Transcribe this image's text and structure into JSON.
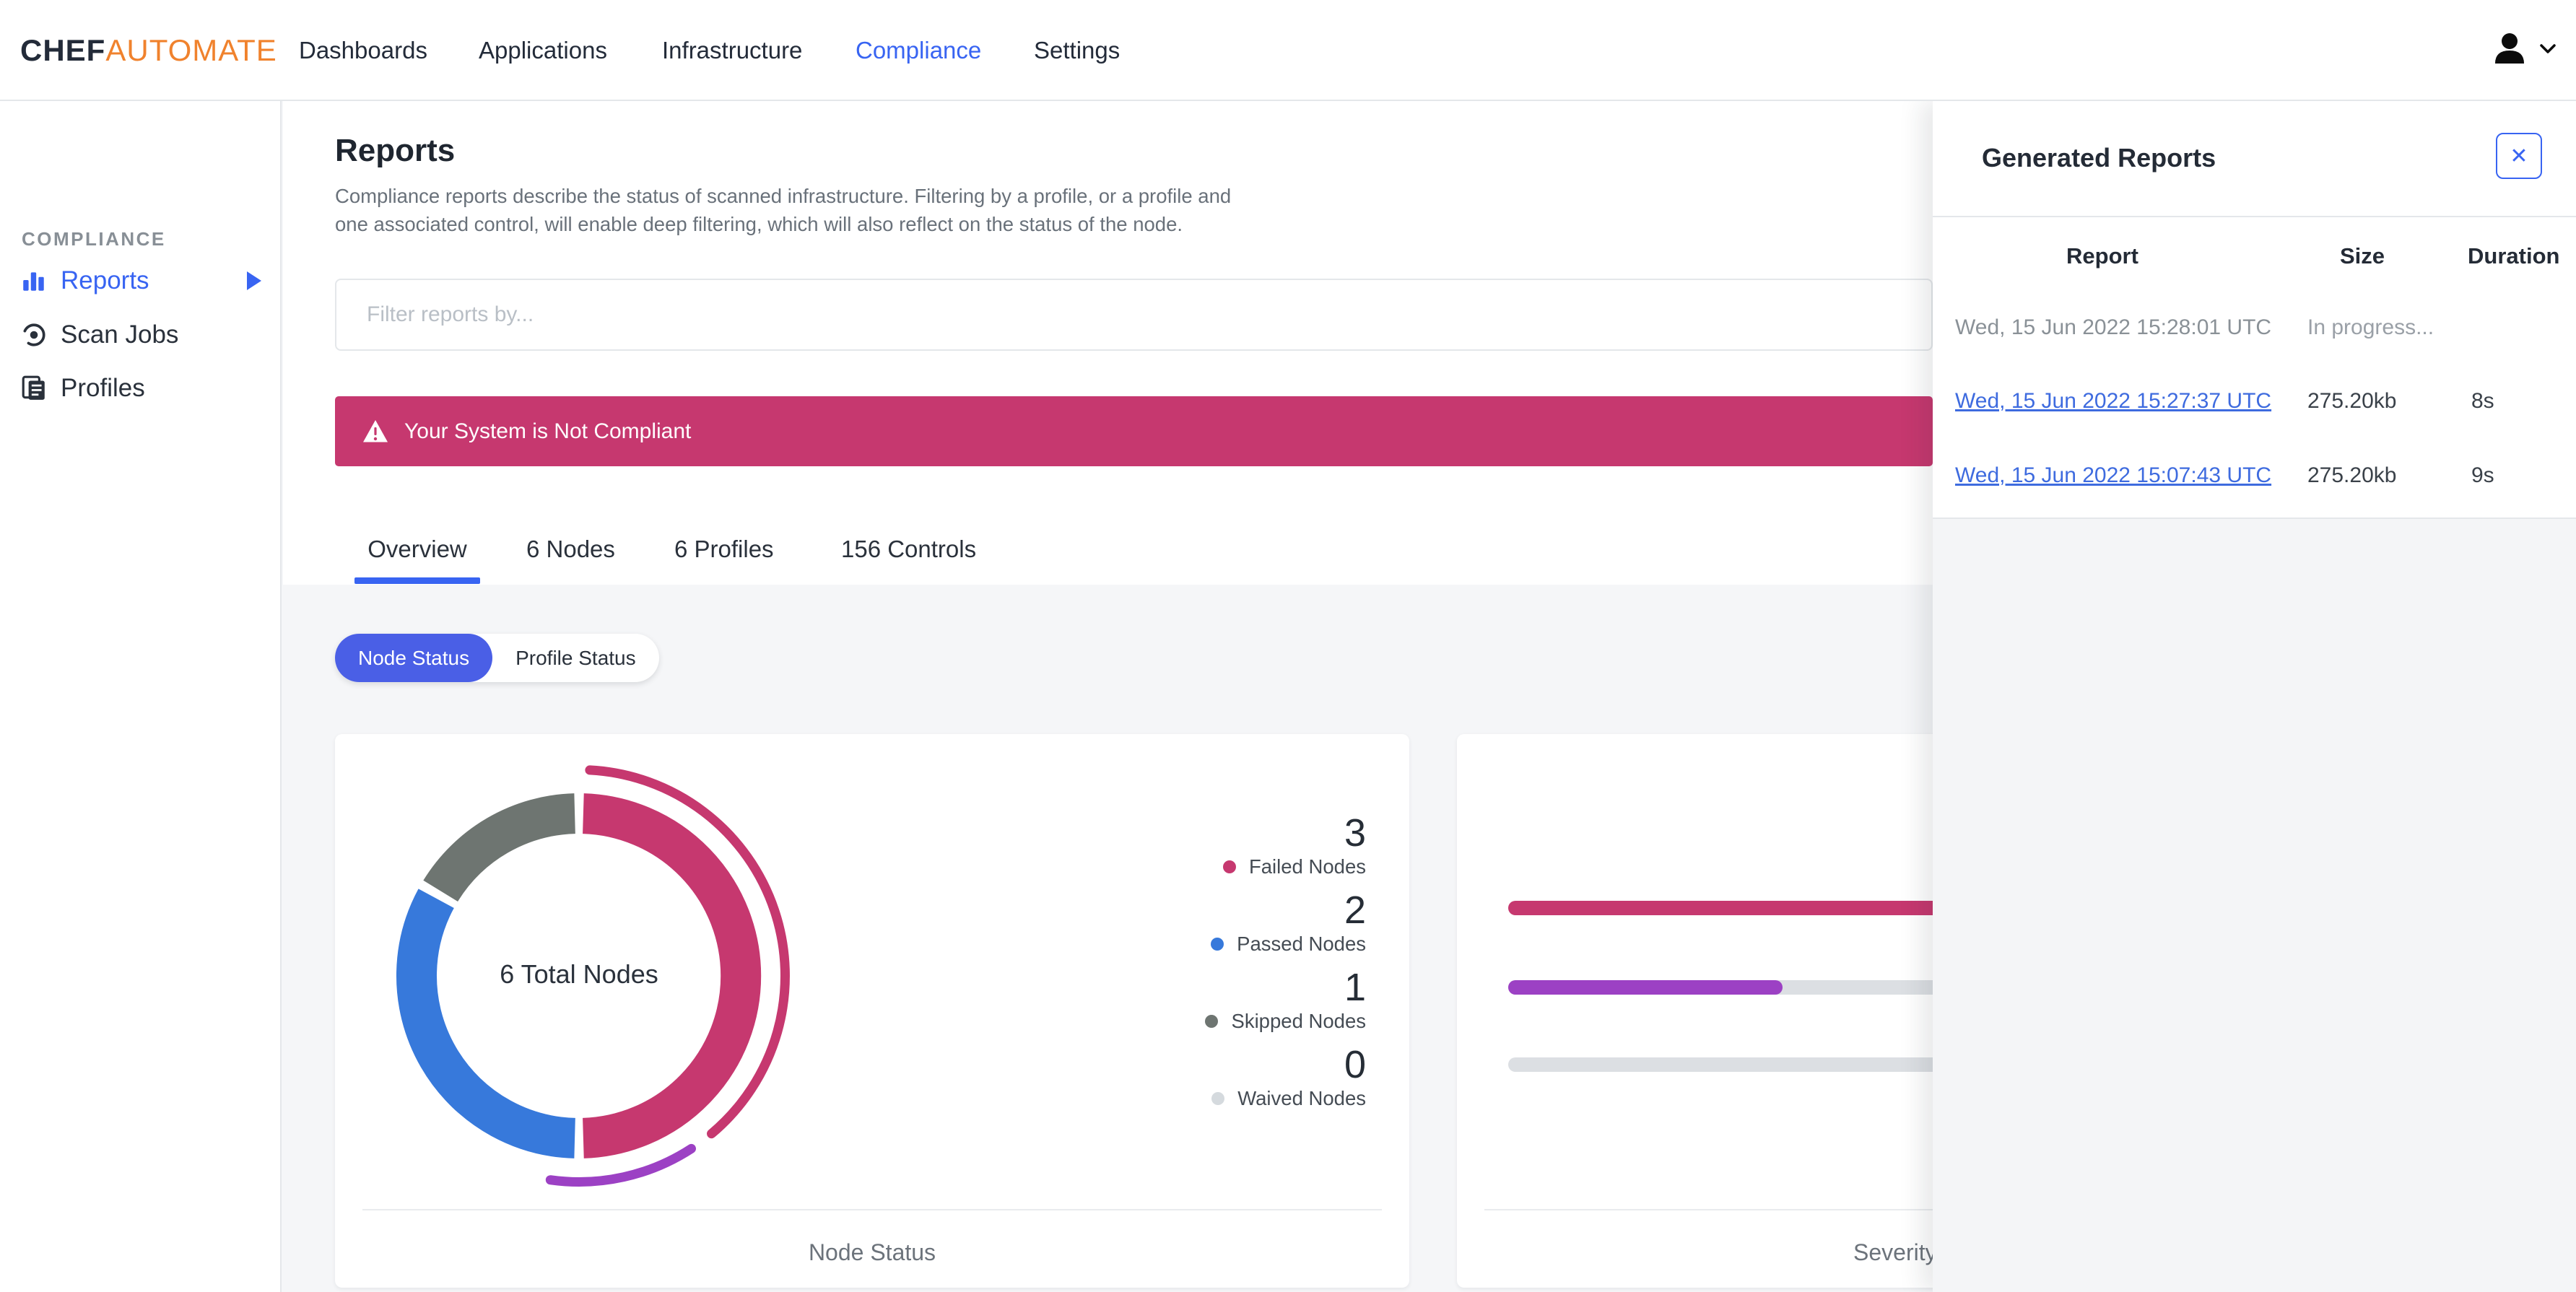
{
  "nav": {
    "brand": {
      "chef": "CHEF",
      "automate": "AUTOMATE"
    },
    "items": [
      {
        "label": "Dashboards"
      },
      {
        "label": "Applications"
      },
      {
        "label": "Infrastructure"
      },
      {
        "label": "Compliance"
      },
      {
        "label": "Settings"
      }
    ],
    "active_item": "Compliance",
    "user_icon": "person-icon",
    "user_chevron": "chevron-down-icon"
  },
  "sidebar": {
    "heading": "COMPLIANCE",
    "items": [
      {
        "label": "Reports",
        "icon": "bar-chart-icon"
      },
      {
        "label": "Scan Jobs",
        "icon": "broadcast-icon"
      },
      {
        "label": "Profiles",
        "icon": "documents-icon"
      }
    ],
    "active_item": "Reports"
  },
  "main": {
    "title": "Reports",
    "description": "Compliance reports describe the status of scanned infrastructure. Filtering by a profile, or a profile and\none associated control, will enable deep filtering, which will also reflect on the status of the node.",
    "filter_placeholder": "Filter reports by...",
    "banner": {
      "text": "Your System is Not Compliant",
      "icon": "warning-triangle-icon"
    },
    "tabs": [
      {
        "label": "Overview"
      },
      {
        "label": "6 Nodes"
      },
      {
        "label": "6 Profiles"
      },
      {
        "label": "156 Controls"
      }
    ],
    "active_tab": "Overview",
    "status_toggle": [
      {
        "label": "Node Status"
      },
      {
        "label": "Profile Status"
      }
    ],
    "active_toggle": "Node Status"
  },
  "node_status_card": {
    "center_label": "6 Total Nodes",
    "legend": [
      {
        "value": "3",
        "label": "Failed Nodes",
        "color": "#C6386F"
      },
      {
        "value": "2",
        "label": "Passed Nodes",
        "color": "#3779DB"
      },
      {
        "value": "1",
        "label": "Skipped Nodes",
        "color": "#6E7571"
      },
      {
        "value": "0",
        "label": "Waived Nodes",
        "color": "#D5DADE"
      }
    ],
    "caption": "Node Status"
  },
  "severity_card": {
    "caption": "Severity"
  },
  "generated_reports": {
    "title": "Generated Reports",
    "close_icon": "✕",
    "columns": [
      "Report",
      "Size",
      "Duration"
    ],
    "rows": [
      {
        "report": "Wed, 15 Jun 2022 15:28:01 UTC",
        "size": "In progress...",
        "duration": ""
      },
      {
        "report": "Wed, 15 Jun 2022 15:27:37 UTC",
        "size": "275.20kb",
        "duration": "8s"
      },
      {
        "report": "Wed, 15 Jun 2022 15:07:43 UTC",
        "size": "275.20kb",
        "duration": "9s"
      }
    ]
  },
  "colors": {
    "brand_blue": "#3864F2",
    "toggle_blue": "#4A5FE6",
    "banner_pink": "#C6386F",
    "failed_pink": "#C6386F",
    "passed_blue": "#3779DB",
    "skipped_gray": "#6E7571",
    "waived_gray": "#D5DADE",
    "severity_purple": "#9C41C4",
    "bar_track": "#DCDFE3",
    "link_blue": "#3E6BDF",
    "brand_orange": "#F0822D"
  },
  "chart_data": [
    {
      "type": "pie",
      "title": "Node Status",
      "center_label": "6 Total Nodes",
      "categories": [
        "Failed Nodes",
        "Passed Nodes",
        "Skipped Nodes",
        "Waived Nodes"
      ],
      "values": [
        3,
        2,
        1,
        0
      ],
      "total": 6,
      "colors": [
        "#C6386F",
        "#3779DB",
        "#6E7571",
        "#D5DADE"
      ],
      "donut": true,
      "outer_arcs": [
        {
          "name": "failed-highlight",
          "color": "#C6386F",
          "start_deg": 3,
          "end_deg": 140
        },
        {
          "name": "severity-highlight",
          "color": "#9C41C4",
          "start_deg": 147,
          "end_deg": 188
        }
      ],
      "legend_position": "right"
    },
    {
      "type": "bar",
      "title": "Severity",
      "orientation": "horizontal",
      "categories": [
        "bar-1",
        "bar-2",
        "bar-3"
      ],
      "series": [
        {
          "name": "bar-1",
          "fraction": 1.0,
          "color": "#C6386F"
        },
        {
          "name": "bar-2",
          "fraction": 0.28,
          "color": "#9C41C4"
        },
        {
          "name": "bar-3",
          "fraction": 0.0,
          "color": "#DCDFE3"
        }
      ],
      "xlim": [
        0,
        1
      ],
      "grid": false
    }
  ]
}
